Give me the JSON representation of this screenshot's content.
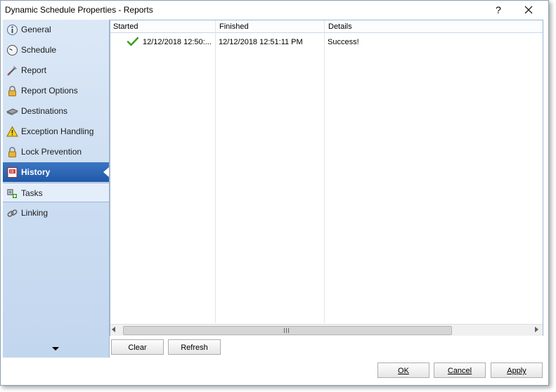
{
  "window": {
    "title": "Dynamic Schedule Properties - Reports",
    "help": "?"
  },
  "sidebar": {
    "items": [
      {
        "label": "General",
        "icon": "info-icon"
      },
      {
        "label": "Schedule",
        "icon": "clock-icon"
      },
      {
        "label": "Report",
        "icon": "report-icon"
      },
      {
        "label": "Report Options",
        "icon": "padlock-icon"
      },
      {
        "label": "Destinations",
        "icon": "destinations-icon"
      },
      {
        "label": "Exception Handling",
        "icon": "warning-icon"
      },
      {
        "label": "Lock Prevention",
        "icon": "padlock-icon"
      },
      {
        "label": "History",
        "icon": "history-icon",
        "active": true
      },
      {
        "label": "Tasks",
        "icon": "tasks-icon"
      },
      {
        "label": "Linking",
        "icon": "link-icon"
      }
    ]
  },
  "history": {
    "columns": [
      "Started",
      "Finished",
      "Details"
    ],
    "rows": [
      {
        "status": "success",
        "started": "12/12/2018 12:50:...",
        "finished": "12/12/2018 12:51:11 PM",
        "details": "Success!"
      }
    ]
  },
  "buttons": {
    "clear": "Clear",
    "refresh": "Refresh",
    "ok": "OK",
    "cancel": "Cancel",
    "apply": "Apply"
  },
  "colors": {
    "active_nav": "#1f5aa8",
    "sidebar_bg": "#cadcf1",
    "success_check": "#3aa320"
  }
}
